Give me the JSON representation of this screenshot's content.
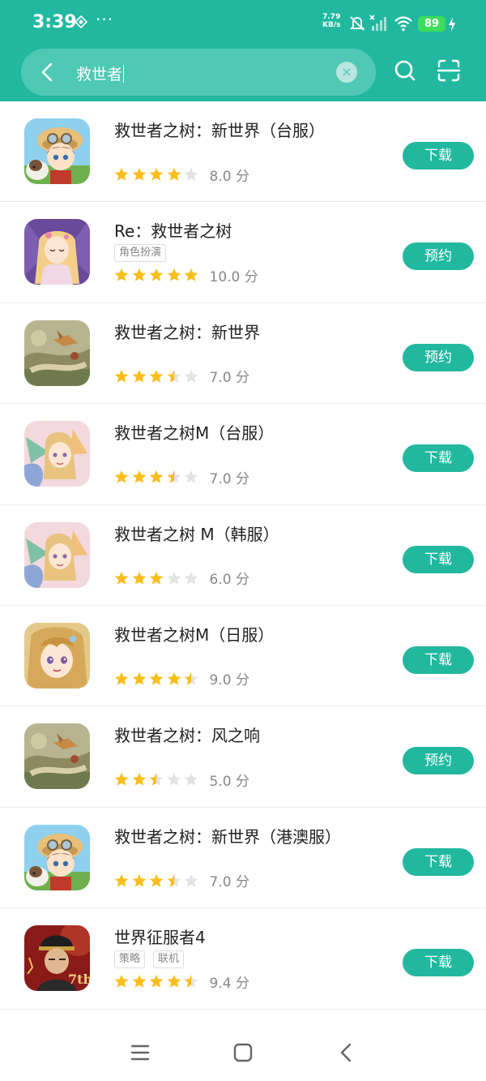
{
  "status_bar": {
    "time": "3:39",
    "net_speed_value": "7.79",
    "net_speed_unit": "KB/s",
    "battery": "89",
    "more": "···"
  },
  "search": {
    "query": "救世者",
    "icons": [
      "back-arrow-icon",
      "clear-icon",
      "search-icon",
      "scan-icon"
    ]
  },
  "colors": {
    "primary": "#22b8a0",
    "star_on": "#fbbd1a",
    "star_off": "#e3e3e3"
  },
  "apps": [
    {
      "title": "救世者之树：新世界（台服）",
      "tags": [],
      "stars": 4,
      "score": "8.0 分",
      "action": "下载",
      "icon_style": "chibi"
    },
    {
      "title": "Re：救世者之树",
      "tags": [
        "角色扮演"
      ],
      "stars": 5,
      "score": "10.0 分",
      "action": "预约",
      "icon_style": "purple"
    },
    {
      "title": "救世者之树：新世界",
      "tags": [],
      "stars": 3.5,
      "score": "7.0 分",
      "action": "预约",
      "icon_style": "landscape"
    },
    {
      "title": "救世者之树M（台服）",
      "tags": [],
      "stars": 3.5,
      "score": "7.0 分",
      "action": "下载",
      "icon_style": "fairy"
    },
    {
      "title": "救世者之树 M（韩服）",
      "tags": [],
      "stars": 3,
      "score": "6.0 分",
      "action": "下载",
      "icon_style": "fairy"
    },
    {
      "title": "救世者之树M（日服）",
      "tags": [],
      "stars": 4.5,
      "score": "9.0 分",
      "action": "下载",
      "icon_style": "face"
    },
    {
      "title": "救世者之树：风之响",
      "tags": [],
      "stars": 2.5,
      "score": "5.0 分",
      "action": "预约",
      "icon_style": "landscape"
    },
    {
      "title": "救世者之树：新世界（港澳服）",
      "tags": [],
      "stars": 3.5,
      "score": "7.0 分",
      "action": "下载",
      "icon_style": "chibi"
    },
    {
      "title": "世界征服者4",
      "tags": [
        "策略",
        "联机"
      ],
      "stars": 4.5,
      "score": "9.4 分",
      "action": "下载",
      "icon_style": "general"
    }
  ],
  "navigation": {
    "icons": [
      "menu-icon",
      "home-icon",
      "back-icon"
    ]
  }
}
